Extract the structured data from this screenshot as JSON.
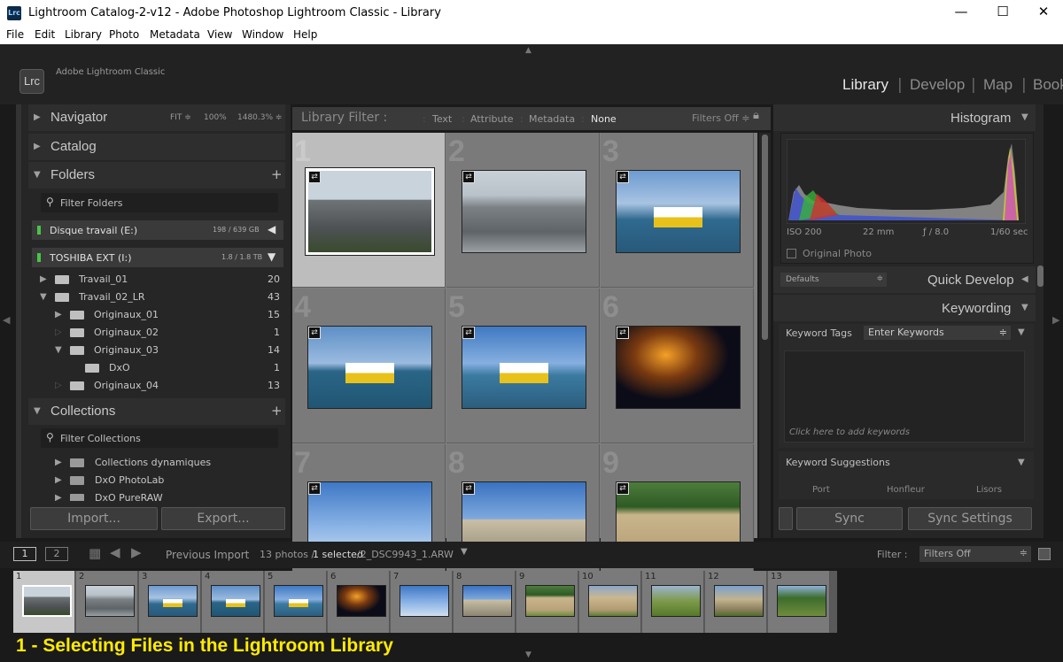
{
  "window": {
    "title": "Lightroom Catalog-2-v12 - Adobe Photoshop Lightroom Classic - Library",
    "app_icon": "Lrc",
    "min": "—",
    "max": "☐",
    "close": "✕"
  },
  "menu": [
    "File",
    "Edit",
    "Library",
    "Photo",
    "Metadata",
    "View",
    "Window",
    "Help"
  ],
  "identity": {
    "logo": "Lrc",
    "product": "Adobe Lightroom Classic"
  },
  "modules": [
    "Library",
    "Develop",
    "Map",
    "Book"
  ],
  "navigator": {
    "label": "Navigator",
    "fit": "FIT ≑",
    "z1": "100%",
    "z2": "1480.3% ≑"
  },
  "catalog": {
    "label": "Catalog"
  },
  "folders": {
    "label": "Folders",
    "filter_placeholder": "Filter Folders",
    "volumes": [
      {
        "name": "Disque travail (E:)",
        "usage": "198 / 639 GB"
      },
      {
        "name": "TOSHIBA EXT (I:)",
        "usage": "1.8 / 1.8 TB"
      }
    ],
    "tree": [
      {
        "name": "Travail_01",
        "count": "20"
      },
      {
        "name": "Travail_02_LR",
        "count": "43"
      },
      {
        "name": "Originaux_01",
        "count": "15"
      },
      {
        "name": "Originaux_02",
        "count": "1"
      },
      {
        "name": "Originaux_03",
        "count": "14"
      },
      {
        "name": "DxO",
        "count": "1"
      },
      {
        "name": "Originaux_04",
        "count": "13"
      }
    ]
  },
  "collections": {
    "label": "Collections",
    "filter_placeholder": "Filter Collections",
    "items": [
      "Collections dynamiques",
      "DxO PhotoLab",
      "DxO PureRAW"
    ]
  },
  "left_buttons": {
    "import": "Import...",
    "export": "Export..."
  },
  "library_filter": {
    "label": "Library Filter :",
    "text": "Text",
    "attribute": "Attribute",
    "metadata": "Metadata",
    "none": "None",
    "filters_off": "Filters Off ≑"
  },
  "grid": {
    "cells": [
      "1",
      "2",
      "3",
      "4",
      "5",
      "6",
      "7",
      "8",
      "9"
    ]
  },
  "histogram": {
    "label": "Histogram",
    "iso": "ISO 200",
    "focal": "22 mm",
    "aperture": "ƒ / 8.0",
    "shutter": "1/60 sec",
    "original_photo": "Original Photo"
  },
  "quick_develop": {
    "label": "Quick Develop",
    "preset": "Defaults"
  },
  "keywording": {
    "label": "Keywording",
    "tags_label": "Keyword Tags",
    "enter_keywords": "Enter Keywords",
    "add_hint": "Click here to add keywords",
    "suggestions_label": "Keyword Suggestions",
    "suggestions": [
      "Port",
      "Honfleur",
      "Lisors"
    ]
  },
  "right_buttons": {
    "sync": "Sync",
    "sync_settings": "Sync Settings"
  },
  "filmbar": {
    "page1": "1",
    "page2": "2",
    "previous_import": "Previous Import",
    "photos": "13 photos /",
    "selected": "1 selected",
    "file": "/2_DSC9943_1.ARW",
    "filter_label": "Filter :",
    "filter_value": "Filters Off"
  },
  "filmstrip": [
    "1",
    "2",
    "3",
    "4",
    "5",
    "6",
    "7",
    "8",
    "9",
    "10",
    "11",
    "12",
    "13"
  ],
  "caption": "1  -  Selecting Files in the Lightroom Library",
  "colors": {
    "caption": "#ffeb00",
    "panel": "#262626",
    "grid": "#808080",
    "selected_cell": "#bdbdbd"
  }
}
